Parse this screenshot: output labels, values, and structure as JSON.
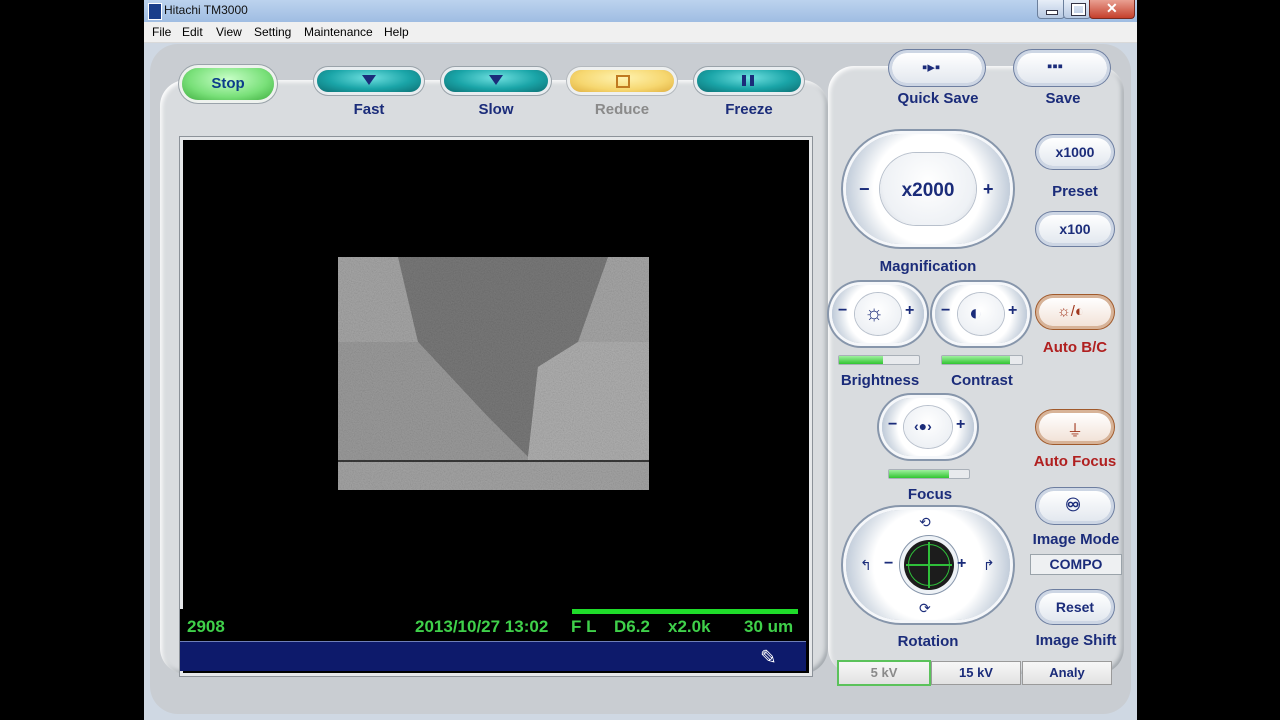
{
  "window": {
    "title": "Hitachi TM3000"
  },
  "menu": [
    "File",
    "Edit",
    "View",
    "Setting",
    "Maintenance",
    "Help"
  ],
  "scan_controls": {
    "stop": "Stop",
    "fast": "Fast",
    "slow": "Slow",
    "reduce": "Reduce",
    "freeze": "Freeze"
  },
  "save": {
    "quick_save": "Quick Save",
    "save": "Save"
  },
  "magnification": {
    "value": "x2000",
    "label": "Magnification",
    "minus": "−",
    "plus": "+"
  },
  "preset": {
    "high": "x1000",
    "label": "Preset",
    "low": "x100"
  },
  "brightness": {
    "label": "Brightness",
    "level": 0.55
  },
  "contrast": {
    "label": "Contrast",
    "level": 0.85
  },
  "auto_bc": {
    "label": "Auto B/C"
  },
  "focus": {
    "label": "Focus",
    "level": 0.75
  },
  "auto_focus": {
    "label": "Auto Focus"
  },
  "rotation": {
    "label": "Rotation"
  },
  "image_mode": {
    "label": "Image Mode",
    "value": "COMPO"
  },
  "image_shift": {
    "reset": "Reset",
    "label": "Image Shift"
  },
  "voltage": {
    "v5": "5 kV",
    "v15": "15 kV",
    "analy": "Analy"
  },
  "status": {
    "number": "2908",
    "datetime": "2013/10/27 13:02",
    "mode": "F L",
    "wd": "D6.2",
    "mag": "x2.0k",
    "scale": "30 um"
  },
  "colors": {
    "status_green": "#3fd04a",
    "label_blue": "#1b2c7a",
    "alert_red": "#b02020"
  }
}
